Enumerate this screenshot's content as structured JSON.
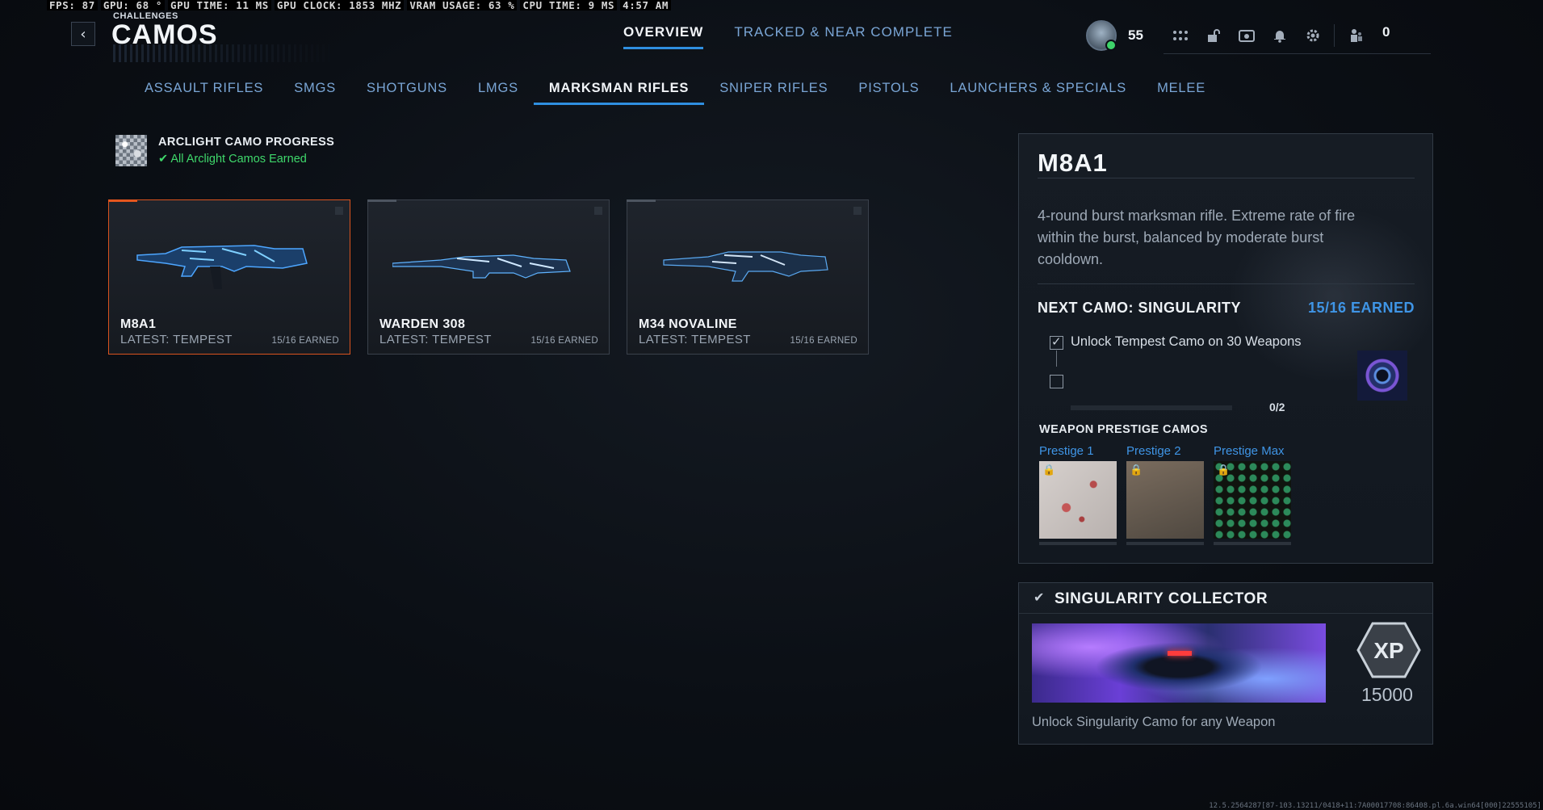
{
  "osd": {
    "fps": "FPS:  87",
    "gpu": "GPU: 68 °",
    "gpu_time": "GPU TIME: 11 MS",
    "gpu_clock": "GPU CLOCK: 1853 MHZ",
    "vram": "VRAM USAGE: 63 %",
    "cpu_time": "CPU TIME:  9 MS",
    "clock": "4:57 AM"
  },
  "header": {
    "breadcrumb": "CHALLENGES",
    "title": "CAMOS",
    "back_glyph": "‹"
  },
  "top_tabs": [
    {
      "label": "OVERVIEW"
    },
    {
      "label": "TRACKED & NEAR COMPLETE"
    }
  ],
  "hud": {
    "level": "55",
    "count": "0",
    "icons": [
      "apps-icon",
      "lock-open-icon",
      "camera-icon",
      "bell-icon",
      "gear-icon",
      "party-icon"
    ]
  },
  "category_tabs": [
    {
      "label": "ASSAULT RIFLES"
    },
    {
      "label": "SMGS"
    },
    {
      "label": "SHOTGUNS"
    },
    {
      "label": "LMGS"
    },
    {
      "label": "MARKSMAN RIFLES"
    },
    {
      "label": "SNIPER RIFLES"
    },
    {
      "label": "PISTOLS"
    },
    {
      "label": "LAUNCHERS & SPECIALS"
    },
    {
      "label": "MELEE"
    }
  ],
  "arclight": {
    "title": "ARCLIGHT CAMO PROGRESS",
    "status": "All Arclight Camos Earned",
    "status_color": "#3fd86b"
  },
  "weapons": [
    {
      "name": "M8A1",
      "latest": "LATEST: TEMPEST",
      "earned": "15/16 EARNED"
    },
    {
      "name": "WARDEN 308",
      "latest": "LATEST: TEMPEST",
      "earned": "15/16 EARNED"
    },
    {
      "name": "M34 NOVALINE",
      "latest": "LATEST: TEMPEST",
      "earned": "15/16 EARNED"
    }
  ],
  "detail": {
    "title": "M8A1",
    "description": "4-round burst marksman rifle. Extreme rate of fire within the burst, balanced by moderate burst cooldown.",
    "next_camo": "NEXT CAMO: SINGULARITY",
    "earned": "15/16 EARNED",
    "challenge": "Unlock Tempest Camo on 30 Weapons",
    "challenge_progress": "0/2",
    "prestige_heading": "WEAPON PRESTIGE CAMOS",
    "prestige": [
      {
        "label": "Prestige 1"
      },
      {
        "label": "Prestige 2"
      },
      {
        "label": "Prestige Max"
      }
    ]
  },
  "collector": {
    "title": "SINGULARITY COLLECTOR",
    "xp_label": "XP",
    "xp_value": "15000",
    "description": "Unlock Singularity Camo for any Weapon"
  },
  "colors": {
    "accent_blue": "#2f8fe0",
    "link_blue": "#3f95e6",
    "selected_orange": "#e5561e",
    "success_green": "#3fd86b"
  },
  "build_info": "12.5.2564287[87-103.13211/0418+11:7A00017708:86408.pl.6a.win64[000]22555105]"
}
